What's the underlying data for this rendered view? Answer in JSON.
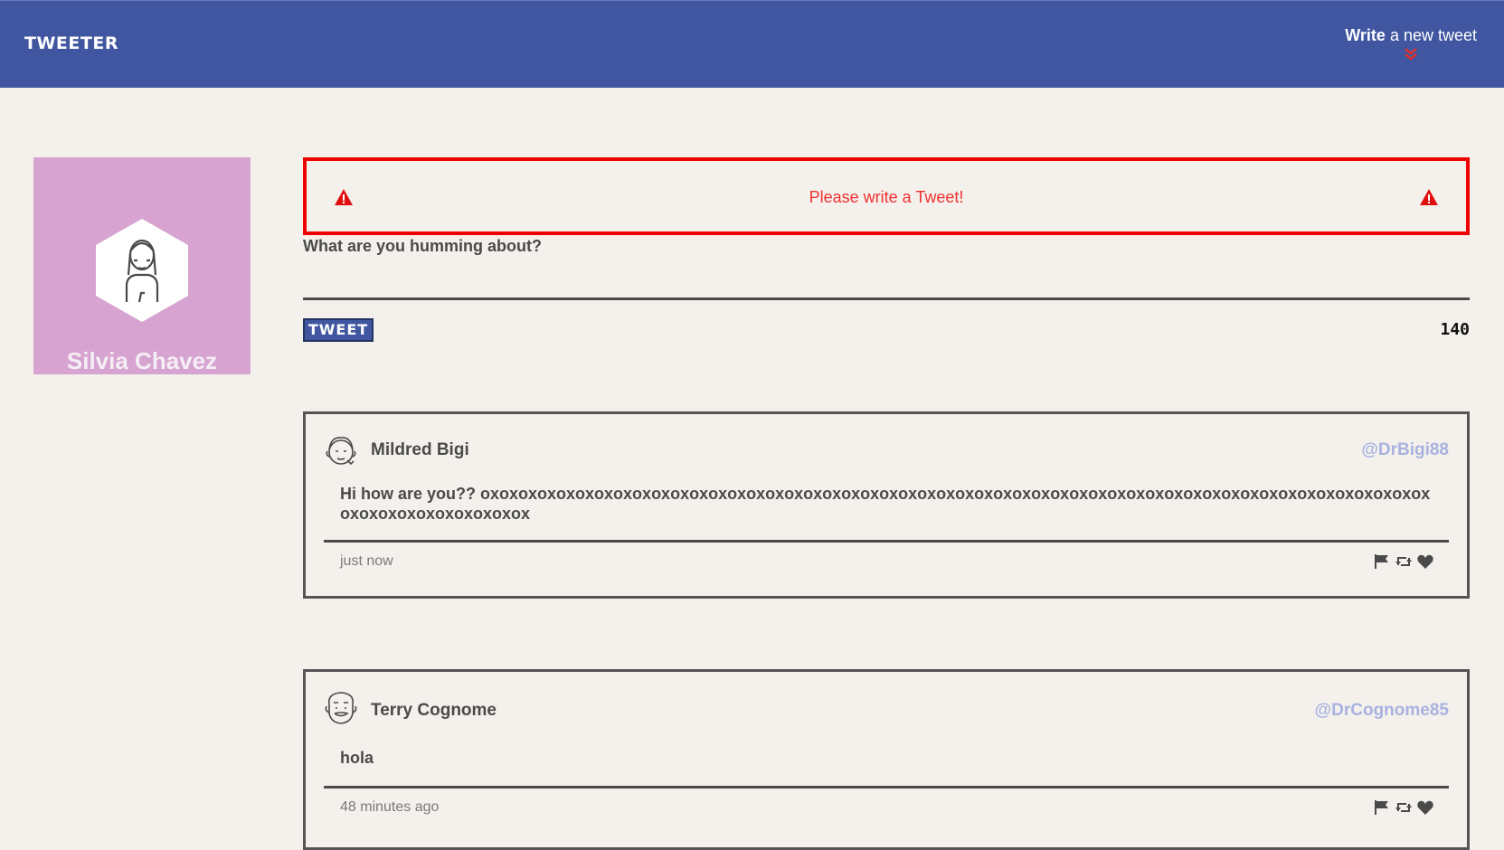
{
  "nav": {
    "logo": "TWEETER",
    "compose_bold": "Write",
    "compose_rest": " a new tweet"
  },
  "profile": {
    "name": "Silvia Chavez"
  },
  "composer": {
    "error_message": "Please write a Tweet!",
    "prompt": "What are you humming about?",
    "submit_label": "TWEET",
    "counter": "140"
  },
  "tweets": [
    {
      "author": "Mildred Bigi",
      "handle": "@DrBigi88",
      "text": "Hi how are you?? oxoxoxoxoxoxoxoxoxoxoxoxoxoxoxoxoxoxoxoxoxoxoxoxoxoxoxoxoxoxoxoxoxoxoxoxoxoxoxoxoxoxoxoxoxoxoxoxoxoxoxoxoxoxoxoxoxoxoxox",
      "time": "just now"
    },
    {
      "author": "Terry Cognome",
      "handle": "@DrCognome85",
      "text": "hola",
      "time": "48 minutes ago"
    }
  ],
  "icons": {
    "compose": "chevron-double-down-icon",
    "error": "warning-triangle-icon",
    "actions": [
      "flag-icon",
      "retweet-icon",
      "heart-icon"
    ]
  },
  "colors": {
    "navbar": "#4056a1",
    "error": "#f00000",
    "background": "#f4f1ec",
    "profile": "#d7a3d1",
    "handle": "#a8b2e0"
  }
}
